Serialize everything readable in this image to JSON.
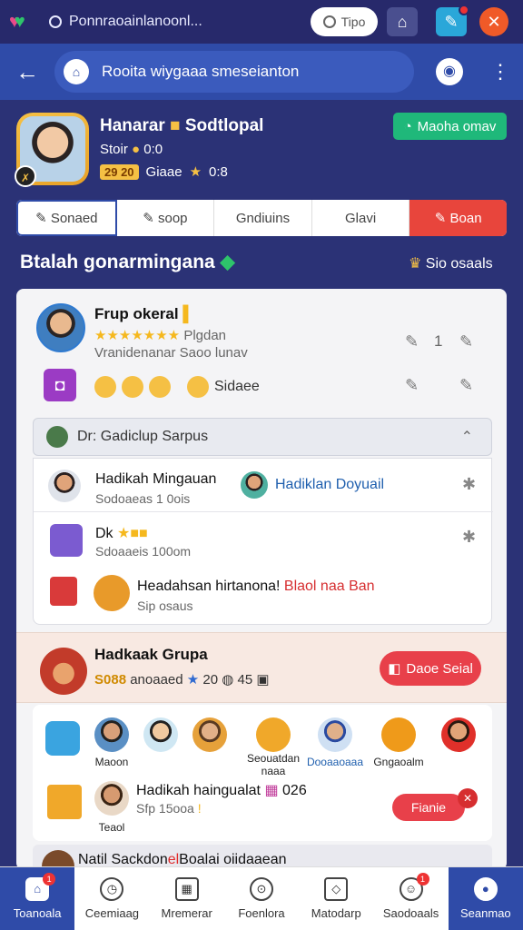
{
  "statusbar": {
    "search_text": "Ponnraoainlanoonl...",
    "pill_label": "Tipo",
    "icons": [
      "hearts-icon",
      "search-icon",
      "clock-icon",
      "building-icon",
      "wrench-icon",
      "tools-icon"
    ]
  },
  "appbar": {
    "address_text": "Rooita wiygaaa smeseianton",
    "icons": [
      "back-arrow-icon",
      "camera-icon",
      "kebab-icon"
    ]
  },
  "profile": {
    "name": "Hanarar",
    "name_suffix": "Sodtlopal",
    "line2": "Stoir",
    "line2_value": "0:0",
    "tag": "29 20",
    "line3_text": "Giaae",
    "line3_value": "0:8",
    "button_label": "Maoha omav"
  },
  "tabs": [
    {
      "label": "Sonaed"
    },
    {
      "label": "soop"
    },
    {
      "label": "Gndiuins"
    },
    {
      "label": "Glavi"
    },
    {
      "label": "Boan"
    }
  ],
  "section": {
    "title": "Btalah gonarmingana",
    "right_label": "Sio osaals"
  },
  "post": {
    "title": "Frup okeral",
    "sub_right": "Plgdan",
    "sub2": "Vranidenanar Saoo lunav",
    "count": "1",
    "emoji_text": "Sidaee"
  },
  "group_header": {
    "label": "Dr: Gadiclup Sarpus"
  },
  "inner_items": [
    {
      "title": "Hadikah Mingauan",
      "sub": "Sodoaeas 1 0ois",
      "link": "Hadiklan Doyuail"
    },
    {
      "title": "Dk",
      "sub": "Sdoaaeis 100om"
    },
    {
      "title": "Headahsan hirtanona!",
      "link": "Blaol naa Ban",
      "sub": "Sip osaus"
    }
  ],
  "group2": {
    "title": "Hadkaak Grupa",
    "sub_value": "S088",
    "sub_text": "anoaaed",
    "sub_count": "20",
    "sub_count2": "45",
    "button_label": "Daoe Seial"
  },
  "members": [
    {
      "label": "Maoon"
    },
    {
      "label": ""
    },
    {
      "label": ""
    },
    {
      "label": "Seouatdan naaa"
    },
    {
      "label": "Dooaaoaaa"
    },
    {
      "label": "Gngaoalm"
    },
    {
      "label": ""
    }
  ],
  "members_row2": {
    "title": "Hadikah haingualat",
    "title_value": "026",
    "sub": "Sfp 15ooa",
    "avatar_label": "Teaol",
    "button_label": "Fianie"
  },
  "peek": {
    "prefix": "Natil Sackdon",
    "highlight": "el",
    "suffix": "Boalai oiidaaean"
  },
  "bottom_nav": [
    {
      "label": "Toanoala",
      "icon": "home-icon"
    },
    {
      "label": "Ceemiaag",
      "icon": "clock-icon"
    },
    {
      "label": "Mremerar",
      "icon": "grid-icon"
    },
    {
      "label": "Foenlora",
      "icon": "compass-icon"
    },
    {
      "label": "Matodarp",
      "icon": "box-icon"
    },
    {
      "label": "Saodoaals",
      "icon": "smile-icon"
    },
    {
      "label": "Seanmao",
      "icon": "person-icon"
    }
  ]
}
